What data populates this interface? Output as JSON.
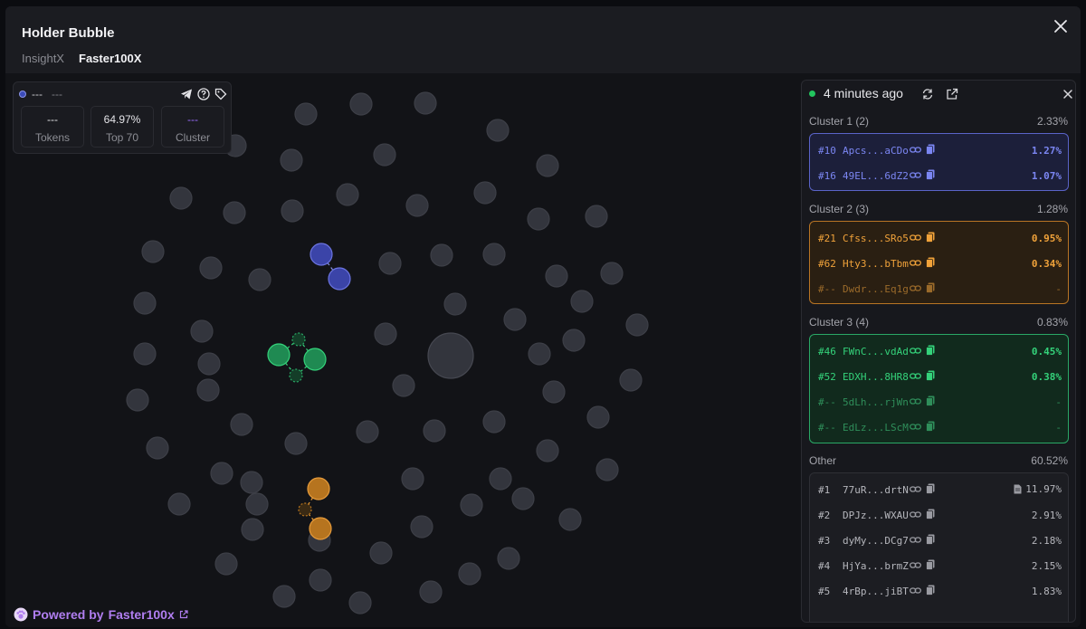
{
  "header": {
    "title": "Holder Bubble",
    "tabs": [
      "InsightX",
      "Faster100X"
    ]
  },
  "info": {
    "name": "---",
    "symbol": "---",
    "stats": [
      {
        "value": "---",
        "label": "Tokens"
      },
      {
        "value": "64.97%",
        "label": "Top 70"
      },
      {
        "value": "---",
        "label": "Cluster"
      }
    ]
  },
  "powered": {
    "prefix": "Powered by",
    "brand": "Faster100x"
  },
  "panel": {
    "time": "4 minutes ago",
    "clusters": [
      {
        "title": "Cluster 1 (2)",
        "pct": "2.33%",
        "color": "#7b86f2",
        "rows": [
          {
            "rank": "#10",
            "addr": "Apcs...aCDo",
            "pct": "1.27%"
          },
          {
            "rank": "#16",
            "addr": "49EL...6dZ2",
            "pct": "1.07%"
          }
        ]
      },
      {
        "title": "Cluster 2 (3)",
        "pct": "1.28%",
        "color": "#f0a23a",
        "rows": [
          {
            "rank": "#21",
            "addr": "Cfss...SRo5",
            "pct": "0.95%"
          },
          {
            "rank": "#62",
            "addr": "Hty3...bTbm",
            "pct": "0.34%"
          },
          {
            "rank": "#--",
            "addr": "Dwdr...Eq1g",
            "pct": "-"
          }
        ]
      },
      {
        "title": "Cluster 3 (4)",
        "pct": "0.83%",
        "color": "#34d27a",
        "rows": [
          {
            "rank": "#46",
            "addr": "FWnC...vdAd",
            "pct": "0.45%"
          },
          {
            "rank": "#52",
            "addr": "EDXH...8HR8",
            "pct": "0.38%"
          },
          {
            "rank": "#--",
            "addr": "5dLh...rjWn",
            "pct": "-"
          },
          {
            "rank": "#--",
            "addr": "EdLz...LScM",
            "pct": "-"
          }
        ]
      }
    ],
    "other": {
      "title": "Other",
      "pct": "60.52%",
      "rows": [
        {
          "rank": "#1",
          "addr": "77uR...drtN",
          "pct": "11.97%"
        },
        {
          "rank": "#2",
          "addr": "DPJz...WXAU",
          "pct": "2.91%"
        },
        {
          "rank": "#3",
          "addr": "dyMy...DCg7",
          "pct": "2.18%"
        },
        {
          "rank": "#4",
          "addr": "HjYa...brmZ",
          "pct": "2.15%"
        },
        {
          "rank": "#5",
          "addr": "4rBp...jiBT",
          "pct": "1.83%"
        }
      ]
    }
  }
}
